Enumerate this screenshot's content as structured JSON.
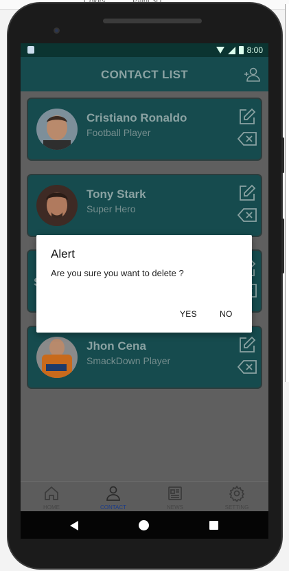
{
  "background_window": {
    "texts": [
      "Colors",
      "Paint 3D"
    ]
  },
  "status_bar": {
    "time": "8:00"
  },
  "app_bar": {
    "title": "CONTACT LIST",
    "add_icon": "add-user-icon"
  },
  "contacts": [
    {
      "name": "Cristiano Ronaldo",
      "role": "Football Player"
    },
    {
      "name": "Tony Stark",
      "role": "Super Hero"
    },
    {
      "name": "S",
      "role": ""
    },
    {
      "name": "Jhon Cena",
      "role": "SmackDown Player"
    }
  ],
  "dialog": {
    "title": "Alert",
    "message": "Are you sure you want to delete ?",
    "yes_label": "YES",
    "no_label": "NO"
  },
  "bottom_nav": [
    {
      "label": "HOME",
      "icon": "home-icon"
    },
    {
      "label": "CONTACT",
      "icon": "person-icon",
      "active": true
    },
    {
      "label": "NEWS",
      "icon": "news-icon"
    },
    {
      "label": "SETTING",
      "icon": "gear-icon"
    }
  ],
  "colors": {
    "app_bar": "#164b4e",
    "card": "#164b4e",
    "active_nav": "#1a3b8a",
    "dialog": "#ffffff"
  }
}
